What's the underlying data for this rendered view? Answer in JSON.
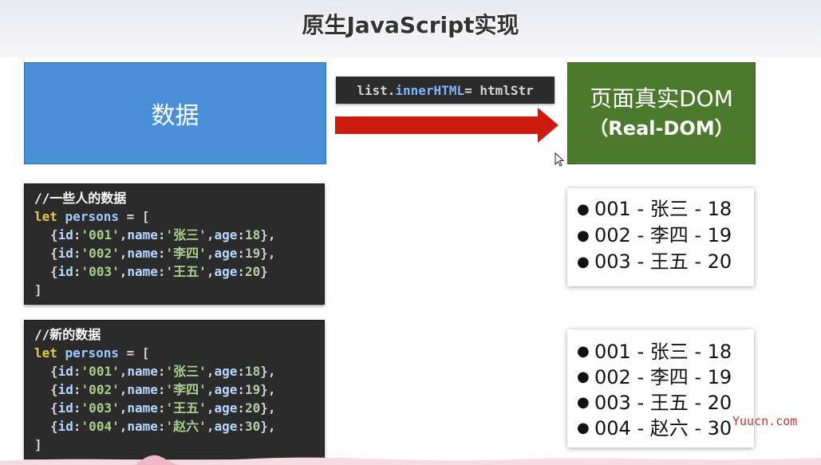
{
  "title": "原生JavaScript实现",
  "data_box": {
    "label": "数据"
  },
  "code_label": {
    "obj": "list.",
    "prop": "innerHTML",
    "rest": " = htmlStr"
  },
  "dom_box": {
    "title": "页面真实DOM",
    "subtitle": "（Real-DOM）"
  },
  "code_block_1": {
    "comment": "//一些人的数据",
    "let_kw": "let",
    "var_name": "persons",
    "assign": " = [",
    "rows": [
      {
        "id": "'001'",
        "name": "'张三'",
        "age": "18",
        "trail": "},"
      },
      {
        "id": "'002'",
        "name": "'李四'",
        "age": "19",
        "trail": "},"
      },
      {
        "id": "'003'",
        "name": "'王五'",
        "age": "20",
        "trail": "}"
      }
    ],
    "close": "]"
  },
  "code_block_2": {
    "comment": "//新的数据",
    "let_kw": "let",
    "var_name": "persons",
    "assign": " = [",
    "rows": [
      {
        "id": "'001'",
        "name": "'张三'",
        "age": "18",
        "trail": "},"
      },
      {
        "id": "'002'",
        "name": "'李四'",
        "age": "19",
        "trail": "},"
      },
      {
        "id": "'003'",
        "name": "'王五'",
        "age": "20",
        "trail": "},"
      },
      {
        "id": "'004'",
        "name": "'赵六'",
        "age": "30",
        "trail": "},"
      }
    ],
    "close": "]"
  },
  "list_1": [
    "001 - 张三 - 18",
    "002 - 李四 - 19",
    "003 - 王五 - 20"
  ],
  "list_2": [
    "001 - 张三 - 18",
    "002 - 李四 - 19",
    "003 - 王五 - 20",
    "004 - 赵六 - 30"
  ],
  "watermark": "Yuucn.com",
  "colors": {
    "data_box": "#4a90d9",
    "dom_box": "#4b7a2c",
    "arrow": "#cc1a0e",
    "code_bg": "#2b2b2b"
  },
  "icons": {
    "bullet": "bullet-icon",
    "arrow": "right-arrow-icon",
    "cursor": "mouse-cursor-icon"
  }
}
